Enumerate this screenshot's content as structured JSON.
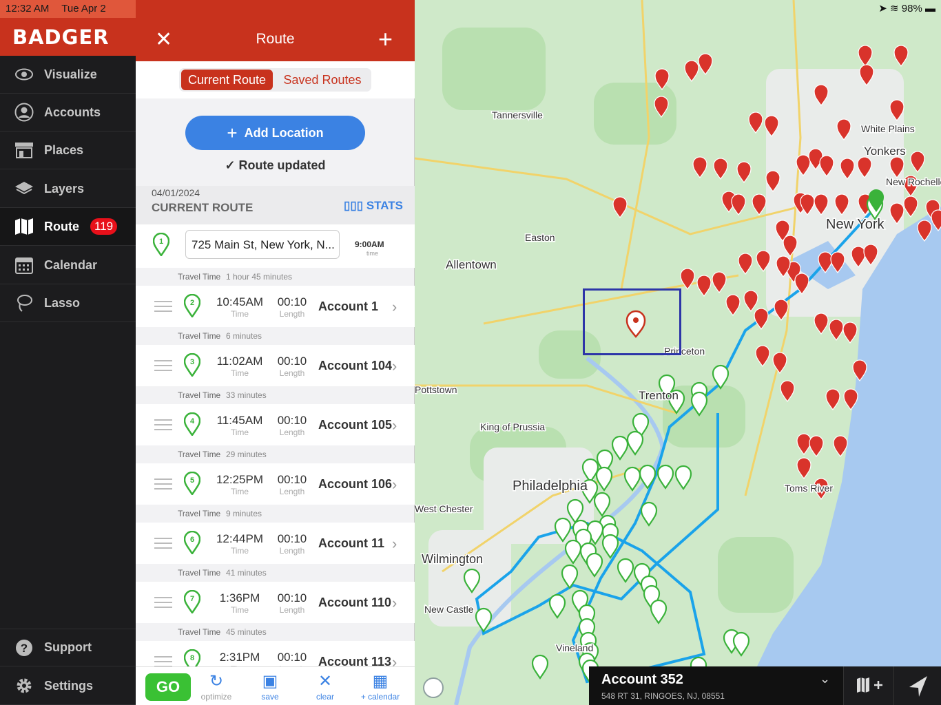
{
  "status": {
    "time": "12:32 AM",
    "date": "Tue Apr 2",
    "battery": "98%"
  },
  "brand": "BADGER",
  "nav": [
    {
      "label": "Visualize",
      "icon": "eye-icon"
    },
    {
      "label": "Accounts",
      "icon": "user-icon"
    },
    {
      "label": "Places",
      "icon": "store-icon"
    },
    {
      "label": "Layers",
      "icon": "layers-icon"
    },
    {
      "label": "Route",
      "icon": "map-icon",
      "badge": "119",
      "active": true
    },
    {
      "label": "Calendar",
      "icon": "calendar-icon"
    },
    {
      "label": "Lasso",
      "icon": "lasso-icon"
    }
  ],
  "nav_bottom": [
    {
      "label": "Support",
      "icon": "help-icon"
    },
    {
      "label": "Settings",
      "icon": "gear-icon"
    }
  ],
  "panel": {
    "title": "Route",
    "tabs": {
      "current": "Current Route",
      "saved": "Saved Routes"
    },
    "add_location": "Add Location",
    "route_updated": "Route updated",
    "route_date": "04/01/2024",
    "route_label": "CURRENT ROUTE",
    "stats_label": "STATS",
    "start": {
      "number": "1",
      "address": "725 Main St, New York, N...",
      "time": "9:00AM",
      "time_sub": "time"
    },
    "stops": [
      {
        "number": "2",
        "travel": "1 hour 45 minutes",
        "time": "10:45AM",
        "length": "00:10",
        "account": "Account 1"
      },
      {
        "number": "3",
        "travel": "6 minutes",
        "time": "11:02AM",
        "length": "00:10",
        "account": "Account 104"
      },
      {
        "number": "4",
        "travel": "33 minutes",
        "time": "11:45AM",
        "length": "00:10",
        "account": "Account 105"
      },
      {
        "number": "5",
        "travel": "29 minutes",
        "time": "12:25PM",
        "length": "00:10",
        "account": "Account 106"
      },
      {
        "number": "6",
        "travel": "9 minutes",
        "time": "12:44PM",
        "length": "00:10",
        "account": "Account 11"
      },
      {
        "number": "7",
        "travel": "41 minutes",
        "time": "1:36PM",
        "length": "00:10",
        "account": "Account 110"
      },
      {
        "number": "8",
        "travel": "45 minutes",
        "time": "2:31PM",
        "length": "00:10",
        "account": "Account 113"
      }
    ],
    "labels": {
      "travel_time": "Travel Time",
      "time": "Time",
      "length": "Length"
    },
    "bottom": {
      "go": "GO",
      "optimize": "optimize",
      "save": "save",
      "clear": "clear",
      "calendar": "+ calendar"
    }
  },
  "map": {
    "places": [
      "Tannersville",
      "Easton",
      "Allentown",
      "Princeton",
      "Trenton",
      "King of Prussia",
      "Philadelphia",
      "West Chester",
      "Wilmington",
      "New Castle",
      "Pottstown",
      "Vineland",
      "White Plains",
      "Yonkers",
      "New Rochelle",
      "New York",
      "Toms River"
    ],
    "selected_account": {
      "name": "Account 352",
      "address": "548 RT 31, RINGOES, NJ, 08551"
    }
  }
}
